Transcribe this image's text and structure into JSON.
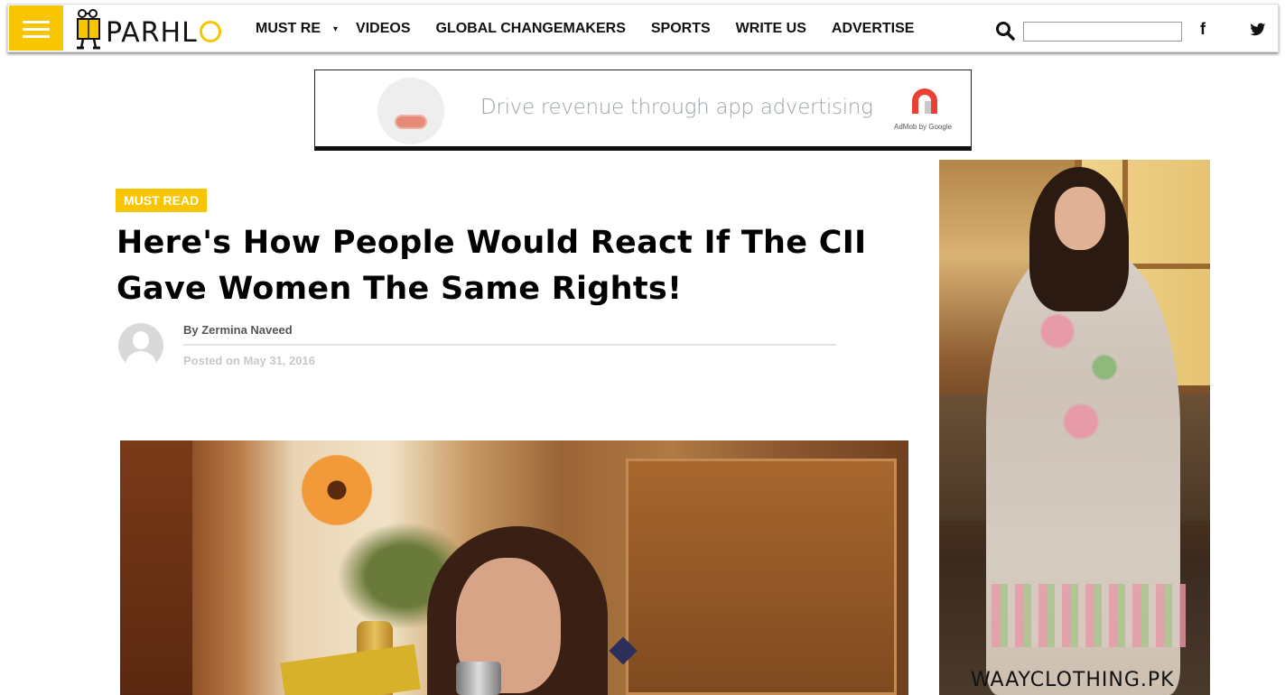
{
  "header": {
    "logo_text": "PARHL",
    "nav": [
      {
        "label": "MUST RE"
      },
      {
        "label": "VIDEOS"
      },
      {
        "label": "GLOBAL CHANGEMAKERS"
      },
      {
        "label": "SPORTS"
      },
      {
        "label": "WRITE US"
      },
      {
        "label": "ADVERTISE"
      }
    ],
    "caret": "▾",
    "search_value": "",
    "facebook_glyph": "f",
    "icons": [
      "menu-icon",
      "search-icon",
      "facebook-icon",
      "twitter-icon"
    ]
  },
  "ad_banner": {
    "text": "Drive revenue through app advertising",
    "caption": "AdMob by Google"
  },
  "article": {
    "category": "MUST READ",
    "headline": "Here's How People Would React If The CII Gave Women The Same Rights!",
    "byline": "By Zermina Naveed",
    "posted": "Posted on May 31, 2016"
  },
  "side_ad": {
    "caption": "WAAYCLOTHING.PK"
  },
  "colors": {
    "brand_yellow": "#f7c600",
    "text_dark": "#111111",
    "meta_gray": "#c8c8c8"
  }
}
